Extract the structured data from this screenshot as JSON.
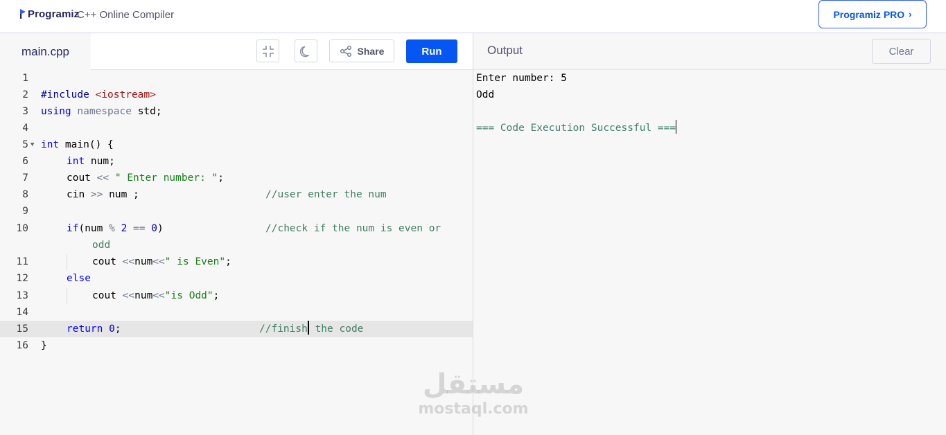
{
  "header": {
    "logo_text": "Programiz",
    "title": "C++ Online Compiler",
    "pro_button": "Programiz PRO",
    "pro_chevron": "›"
  },
  "editor": {
    "filename": "main.cpp",
    "share_label": "Share",
    "run_label": "Run",
    "icons": [
      "compress-icon",
      "moon-icon",
      "share-icon"
    ],
    "line_numbers": [
      "1",
      "2",
      "3",
      "4",
      "5",
      "6",
      "7",
      "8",
      "9",
      "10",
      "11",
      "12",
      "13",
      "14",
      "15",
      "16"
    ],
    "lines": {
      "l2": {
        "a": "#include ",
        "b": "<iostream>"
      },
      "l3": {
        "a": "using",
        "b": " namespace",
        "c": " std;"
      },
      "l5": {
        "a": "int",
        "b": " main() {"
      },
      "l6": {
        "a": "int",
        "b": " num;"
      },
      "l7": {
        "a": "cout ",
        "b": "<<",
        "c": " \" Enter number: \"",
        "d": ";"
      },
      "l8": {
        "a": "cin ",
        "b": ">>",
        "c": " num ;",
        "d": "//user enter the num"
      },
      "l10": {
        "a": "if",
        "b": "(num ",
        "c": "%",
        "d": " ",
        "e": "2",
        "f": " == ",
        "g": "0",
        "h": ")",
        "i": "//check if the num is even or",
        "j": "odd"
      },
      "l11": {
        "a": "cout ",
        "b": "<<",
        "c": "num",
        "d": "<<",
        "e": "\" is Even\"",
        "f": ";"
      },
      "l12": {
        "a": "else"
      },
      "l13": {
        "a": "cout ",
        "b": "<<",
        "c": "num",
        "d": "<<",
        "e": "\"is Odd\"",
        "f": ";"
      },
      "l15": {
        "a": "return",
        "b": " ",
        "c": "0",
        "d": ";",
        "e": "//finish",
        "f": " the code"
      },
      "l16": {
        "a": "}"
      }
    }
  },
  "output": {
    "title": "Output",
    "clear_label": "Clear",
    "lines": [
      "Enter number: 5",
      "Odd",
      "",
      "=== Code Execution Successful ==="
    ]
  },
  "watermark": {
    "arabic": "مستقل",
    "latin": "mostaql.com"
  },
  "colors": {
    "accent": "#0556f3",
    "keyword": "#0000ff",
    "comment": "#3f7f5f",
    "string": "#1a7f1a"
  }
}
